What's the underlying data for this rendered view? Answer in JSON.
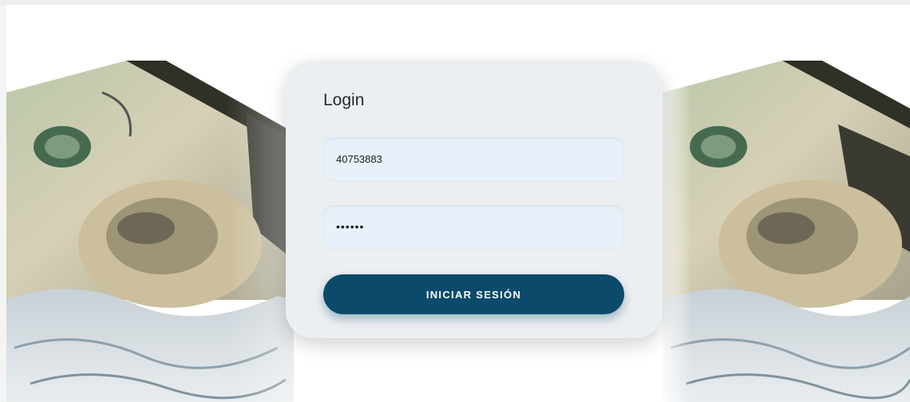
{
  "login": {
    "title": "Login",
    "username_value": "40753883",
    "password_value": "......",
    "submit_label": "INICIAR SESIÓN"
  },
  "colors": {
    "card_background": "#eceff2",
    "field_background": "#e8f1fa",
    "button_background": "#0b4a6a",
    "button_text": "#ffffff"
  },
  "background": {
    "image_subject": "twenty-dollar-bill-in-water"
  }
}
